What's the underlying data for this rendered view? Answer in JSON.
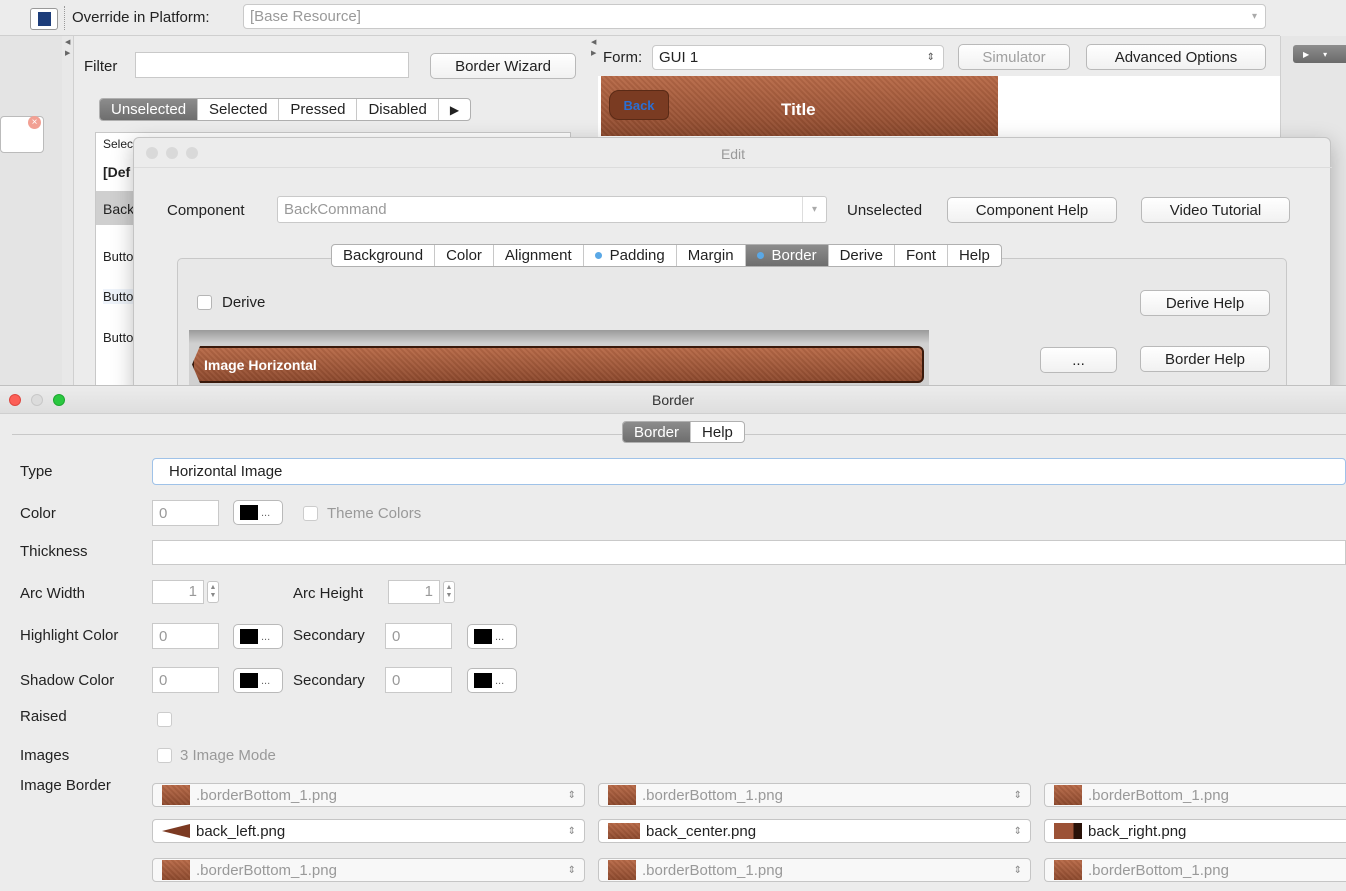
{
  "main": {
    "override_label": "Override in Platform:",
    "override_value": "[Base Resource]",
    "filter_label": "Filter",
    "border_wizard": "Border Wizard",
    "form_label": "Form:",
    "form_value": "GUI 1",
    "simulator": "Simulator",
    "advanced_options": "Advanced Options",
    "state_tabs": [
      "Unselected",
      "Selected",
      "Pressed",
      "Disabled"
    ],
    "state_more": "▶",
    "list_header": "Selec",
    "list_items": [
      "[Def",
      "Back",
      "Butto",
      "Butto",
      "Butto"
    ],
    "preview_back": "Back",
    "preview_title": "Title"
  },
  "edit": {
    "title": "Edit",
    "component_label": "Component",
    "component_value": "BackCommand",
    "state_label": "Unselected",
    "component_help": "Component Help",
    "video_tutorial": "Video Tutorial",
    "tabs": [
      "Background",
      "Color",
      "Alignment",
      "Padding",
      "Margin",
      "Border",
      "Derive",
      "Font",
      "Help"
    ],
    "selected_tab": "Border",
    "derive_label": "Derive",
    "derive_help": "Derive Help",
    "image_preview_label": "Image Horizontal",
    "ellipsis_button": "...",
    "border_help": "Border Help"
  },
  "border": {
    "title": "Border",
    "tabs": [
      "Border",
      "Help"
    ],
    "type_label": "Type",
    "type_value": "Horizontal Image",
    "color_label": "Color",
    "color_value": "0",
    "swatch_ellipsis": "...",
    "theme_colors": "Theme Colors",
    "thickness_label": "Thickness",
    "thickness_value": "",
    "arc_width_label": "Arc Width",
    "arc_width_value": "1",
    "arc_height_label": "Arc Height",
    "arc_height_value": "1",
    "highlight_label": "Highlight Color",
    "highlight_value": "0",
    "highlight_secondary_label": "Secondary",
    "highlight_secondary_value": "0",
    "shadow_label": "Shadow Color",
    "shadow_value": "0",
    "shadow_secondary_label": "Secondary",
    "shadow_secondary_value": "0",
    "raised_label": "Raised",
    "images_label": "Images",
    "three_image_mode": "3 Image Mode",
    "image_border_label": "Image Border",
    "image_rows": [
      [
        ".borderBottom_1.png",
        ".borderBottom_1.png",
        ".borderBottom_1.png"
      ],
      [
        "back_left.png",
        "back_center.png",
        "back_right.png"
      ],
      [
        ".borderBottom_1.png",
        ".borderBottom_1.png",
        ".borderBottom_1.png"
      ]
    ]
  },
  "colors": {
    "accent": "#5aa8e6",
    "leather": "#9c5236",
    "close_red": "#fc5f57",
    "zoom_green": "#2ac840"
  }
}
